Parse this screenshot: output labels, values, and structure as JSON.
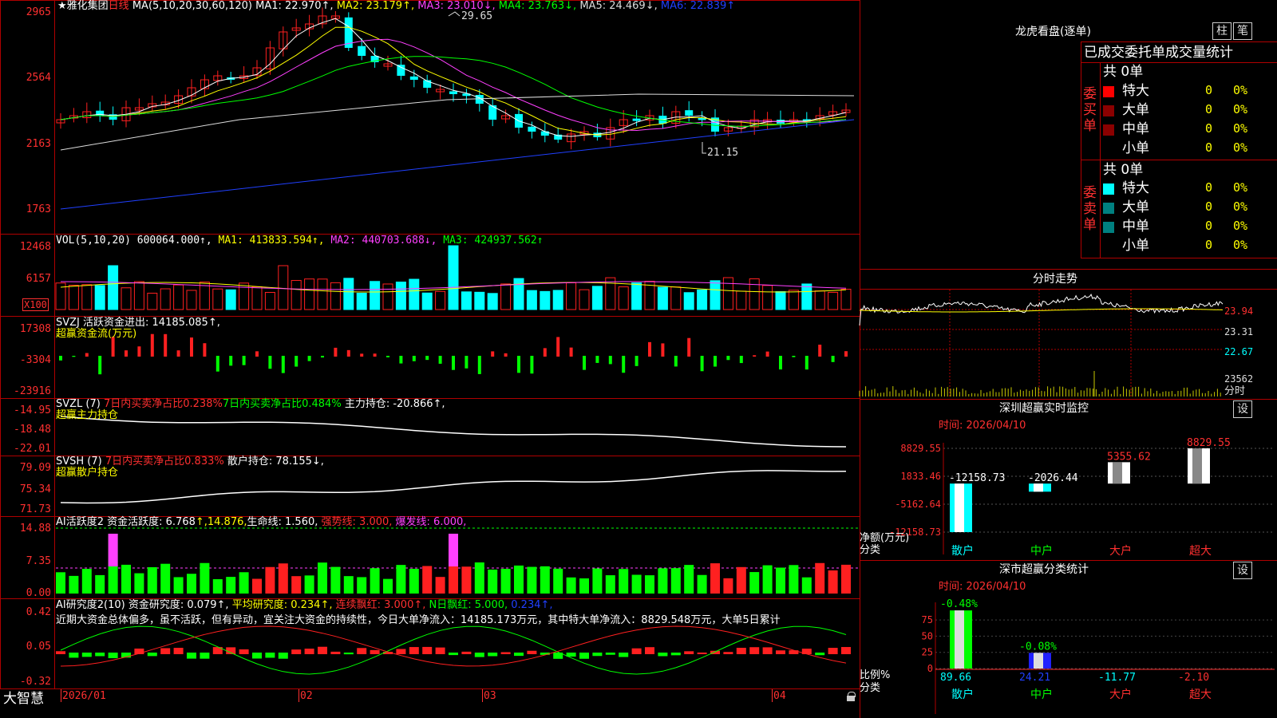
{
  "colors": {
    "up": "#ff2020",
    "down": "#00ffff",
    "green": "#00ff00",
    "bg": "#000000",
    "grid": "#b00000"
  },
  "main": {
    "star": "★",
    "stock_name": "雅化集团",
    "period": "日线",
    "ma_params": "MA(5,10,20,30,60,120)",
    "ma1": "MA1: 22.970↑,",
    "ma2": "MA2: 23.179↑,",
    "ma3": "MA3: 23.010↓,",
    "ma4": "MA4: 23.763↓,",
    "ma5": "MA5: 24.469↓,",
    "ma6": "MA6: 22.839↑",
    "yaxis": [
      "2965",
      "2564",
      "2163",
      "1763"
    ],
    "high_label": "29.65",
    "low_label": "21.15"
  },
  "vol": {
    "params": "VOL(5,10,20)",
    "value": "600064.000↑,",
    "ma1": "MA1: 413833.594↑,",
    "ma2": "MA2: 440703.688↓,",
    "ma3": "MA3: 424937.562↑",
    "yaxis": [
      "12468",
      "6157"
    ],
    "unit": "X100"
  },
  "svzj": {
    "line1": "SVZJ   活跃资金进出: 14185.085↑,",
    "line2": "超赢资金流(万元)",
    "yaxis": [
      "17308",
      "-3304",
      "-23916"
    ]
  },
  "svzl": {
    "prefix": "SVZL (7)",
    "red_text": "7日内买卖净占比0.238%",
    "green_text": "7日内买卖净占比0.484%",
    "tail": "主力持仓: -20.866↑,",
    "line2": "超赢主力持仓",
    "yaxis": [
      "-14.95",
      "-18.48",
      "-22.01"
    ]
  },
  "svsh": {
    "prefix": "SVSH (7)",
    "red_text": "7日内买卖净占比0.833%",
    "tail": "散户持仓: 78.155↓,",
    "line2": "超赢散户持仓",
    "yaxis": [
      "79.09",
      "75.34",
      "71.73"
    ]
  },
  "ai1": {
    "a": "AI活跃度2 资金活跃度: 6.768",
    "b": "↑,14.876,",
    "c": "生命线: 1.560,",
    "d": "强势线: 3.000,",
    "e": "爆发线: 6.000,",
    "yaxis": [
      "14.88",
      "7.35",
      "0.00"
    ]
  },
  "ai2": {
    "a": "AI研究度2(10) 资金研究度: 0.079↑,",
    "b": "平均研究度: 0.234↑,",
    "c": "连续飘红: 3.000↑,",
    "d": "N日飘红: 5.000,",
    "e": "0.234↑,",
    "desc": "近期大资金总体偏多，虽不活跃，但有异动，宜关注大资金的持续性，今日大单净流入：14185.173万元，其中特大单净流入：8829.548万元，大单5日累计",
    "yaxis": [
      "0.42",
      "0.05",
      "-0.32"
    ]
  },
  "bottom": {
    "brand": "大智慧",
    "months": [
      "2026/01",
      "02",
      "03",
      "04"
    ]
  },
  "right": {
    "lhkp_title": "龙虎看盘(逐单)",
    "btn_zhu": "柱",
    "btn_bi": "笔",
    "tabs": "已成交委托单成交量统计",
    "buy_label": "委买单",
    "sell_label": "委卖单",
    "buy_total": "共 0单",
    "sell_total": "共 0单",
    "rows_buy": [
      {
        "name": "特大",
        "v": "0",
        "p": "0%"
      },
      {
        "name": "大单",
        "v": "0",
        "p": "0%"
      },
      {
        "name": "中单",
        "v": "0",
        "p": "0%"
      },
      {
        "name": "小单",
        "v": "0",
        "p": "0%"
      }
    ],
    "rows_sell": [
      {
        "name": "特大",
        "v": "0",
        "p": "0%"
      },
      {
        "name": "大单",
        "v": "0",
        "p": "0%"
      },
      {
        "name": "中单",
        "v": "0",
        "p": "0%"
      },
      {
        "name": "小单",
        "v": "0",
        "p": "0%"
      }
    ],
    "fenshi_title": "分时走势",
    "fenshi_y": [
      "23.94",
      "23.31",
      "22.67",
      "23562",
      "分时"
    ],
    "monitor_title": "深圳超赢实时监控",
    "btn_set": "设",
    "monitor_time": "时间: 2026/04/10",
    "monitor_y": [
      "8829.55",
      "1833.46",
      "-5162.64",
      "-12158.73"
    ],
    "monitor_vals": [
      "-12158.73",
      "-2026.44",
      "5355.62",
      "8829.55"
    ],
    "monitor_ylabel": "净额(万元)",
    "monitor_xlabel": "分类",
    "cats": [
      "散户",
      "中户",
      "大户",
      "超大"
    ],
    "class_title": "深市超赢分类统计",
    "class_time": "时间: 2026/04/10",
    "class_y": [
      "75",
      "50",
      "25",
      "0"
    ],
    "class_top": [
      "-0.48%",
      "-0.08%"
    ],
    "class_vals": [
      "89.66",
      "24.21",
      "-11.77",
      "-2.10"
    ],
    "class_ylabel": "比例%",
    "class_xlabel": "分类"
  },
  "chart_data": {
    "type": "bar",
    "title": "深圳超赢实时监控",
    "categories": [
      "散户",
      "中户",
      "大户",
      "超大"
    ],
    "values": [
      -12158.73,
      -2026.44,
      5355.62,
      8829.55
    ],
    "ylabel": "净额(万元)",
    "ylim": [
      -12158.73,
      8829.55
    ]
  }
}
